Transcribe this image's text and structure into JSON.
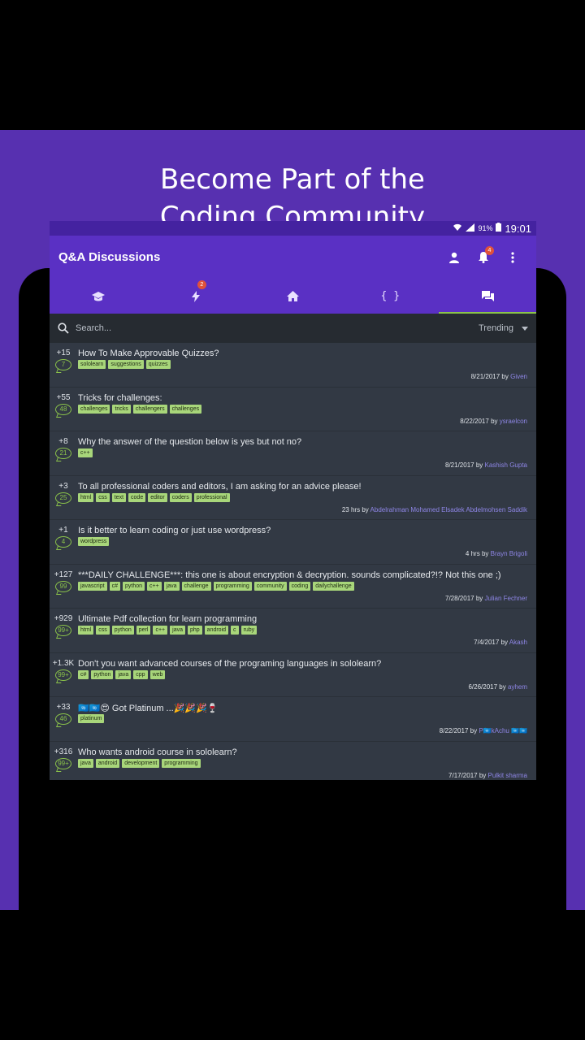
{
  "headline": {
    "line1": "Become Part of the",
    "line2": "Coding Community"
  },
  "status_bar": {
    "battery": "91%",
    "time": "19:01"
  },
  "toolbar": {
    "title": "Q&A Discussions",
    "notification_count": "4"
  },
  "tabs": [
    {
      "icon": "graduation-cap-icon"
    },
    {
      "icon": "lightning-icon",
      "badge": "2"
    },
    {
      "icon": "home-icon"
    },
    {
      "icon": "braces-icon",
      "label": "{ }"
    },
    {
      "icon": "chat-icon",
      "active": true
    }
  ],
  "search": {
    "placeholder": "Search...",
    "sort": "Trending"
  },
  "questions": [
    {
      "votes": "+15",
      "answers": "7",
      "title": "How To Make Approvable Quizzes?",
      "tags": [
        "sololearn",
        "suggestions",
        "quizzes"
      ],
      "date": "8/21/2017",
      "by": "by",
      "author": "Given"
    },
    {
      "votes": "+55",
      "answers": "48",
      "title": "Tricks for challenges:",
      "tags": [
        "challenges",
        "tricks",
        "challengers",
        "challenges"
      ],
      "date": "8/22/2017",
      "by": "by",
      "author": "ysraelcon"
    },
    {
      "votes": "+8",
      "answers": "21",
      "title": "Why the answer of the question below is yes but not no?",
      "tags": [
        "c++"
      ],
      "date": "8/21/2017",
      "by": "by",
      "author": "Kashish Gupta"
    },
    {
      "votes": "+3",
      "answers": "25",
      "title": "To all professional coders and editors, I am asking for an advice please!",
      "tags": [
        "html",
        "css",
        "text",
        "code",
        "editor",
        "coders",
        "professional"
      ],
      "date": "23 hrs",
      "by": "by",
      "author": "Abdelrahman Mohamed Elsadek Abdelmohsen Saddik"
    },
    {
      "votes": "+1",
      "answers": "4",
      "title": "Is it better to learn coding or just use wordpress?",
      "tags": [
        "wordpress"
      ],
      "date": "4 hrs",
      "by": "by",
      "author": "Brayn Brigoli"
    },
    {
      "votes": "+127",
      "answers": "99",
      "title": "***DAILY CHALLENGE***: this one is about encryption & decryption. sounds complicated?!? Not this one ;)",
      "tags": [
        "javascript",
        "c#",
        "python",
        "c++",
        "java",
        "challenge",
        "programming",
        "community",
        "coding",
        "dailychallenge"
      ],
      "date": "7/28/2017",
      "by": "by",
      "author": "Julian Fechner"
    },
    {
      "votes": "+929",
      "answers": "99+",
      "title": "Ultimate Pdf collection for learn programming",
      "tags": [
        "html",
        "css",
        "python",
        "perl",
        "c++",
        "java",
        "php",
        "android",
        "c",
        "ruby"
      ],
      "date": "7/4/2017",
      "by": "by",
      "author": "Akash"
    },
    {
      "votes": "+1.3K",
      "answers": "99+",
      "title": "Don't you want advanced courses of the programing languages in sololearn?",
      "tags": [
        "c#",
        "python",
        "java",
        "cpp",
        "web"
      ],
      "date": "6/26/2017",
      "by": "by",
      "author": "ayhem"
    },
    {
      "votes": "+33",
      "answers": "46",
      "title": "🇺🇳🇺🇳😍 Got Platinum ...🎉🎉🎉🍷",
      "tags": [
        "platinum"
      ],
      "date": "8/22/2017",
      "by": "by",
      "author": "P🇺🇳kAchu 🇺🇳🇺🇳"
    },
    {
      "votes": "+316",
      "answers": "99+",
      "title": "Who wants android course in sololearn?",
      "tags": [
        "java",
        "android",
        "development",
        "programming"
      ],
      "date": "7/17/2017",
      "by": "by",
      "author": "Pulkit sharma"
    }
  ]
}
